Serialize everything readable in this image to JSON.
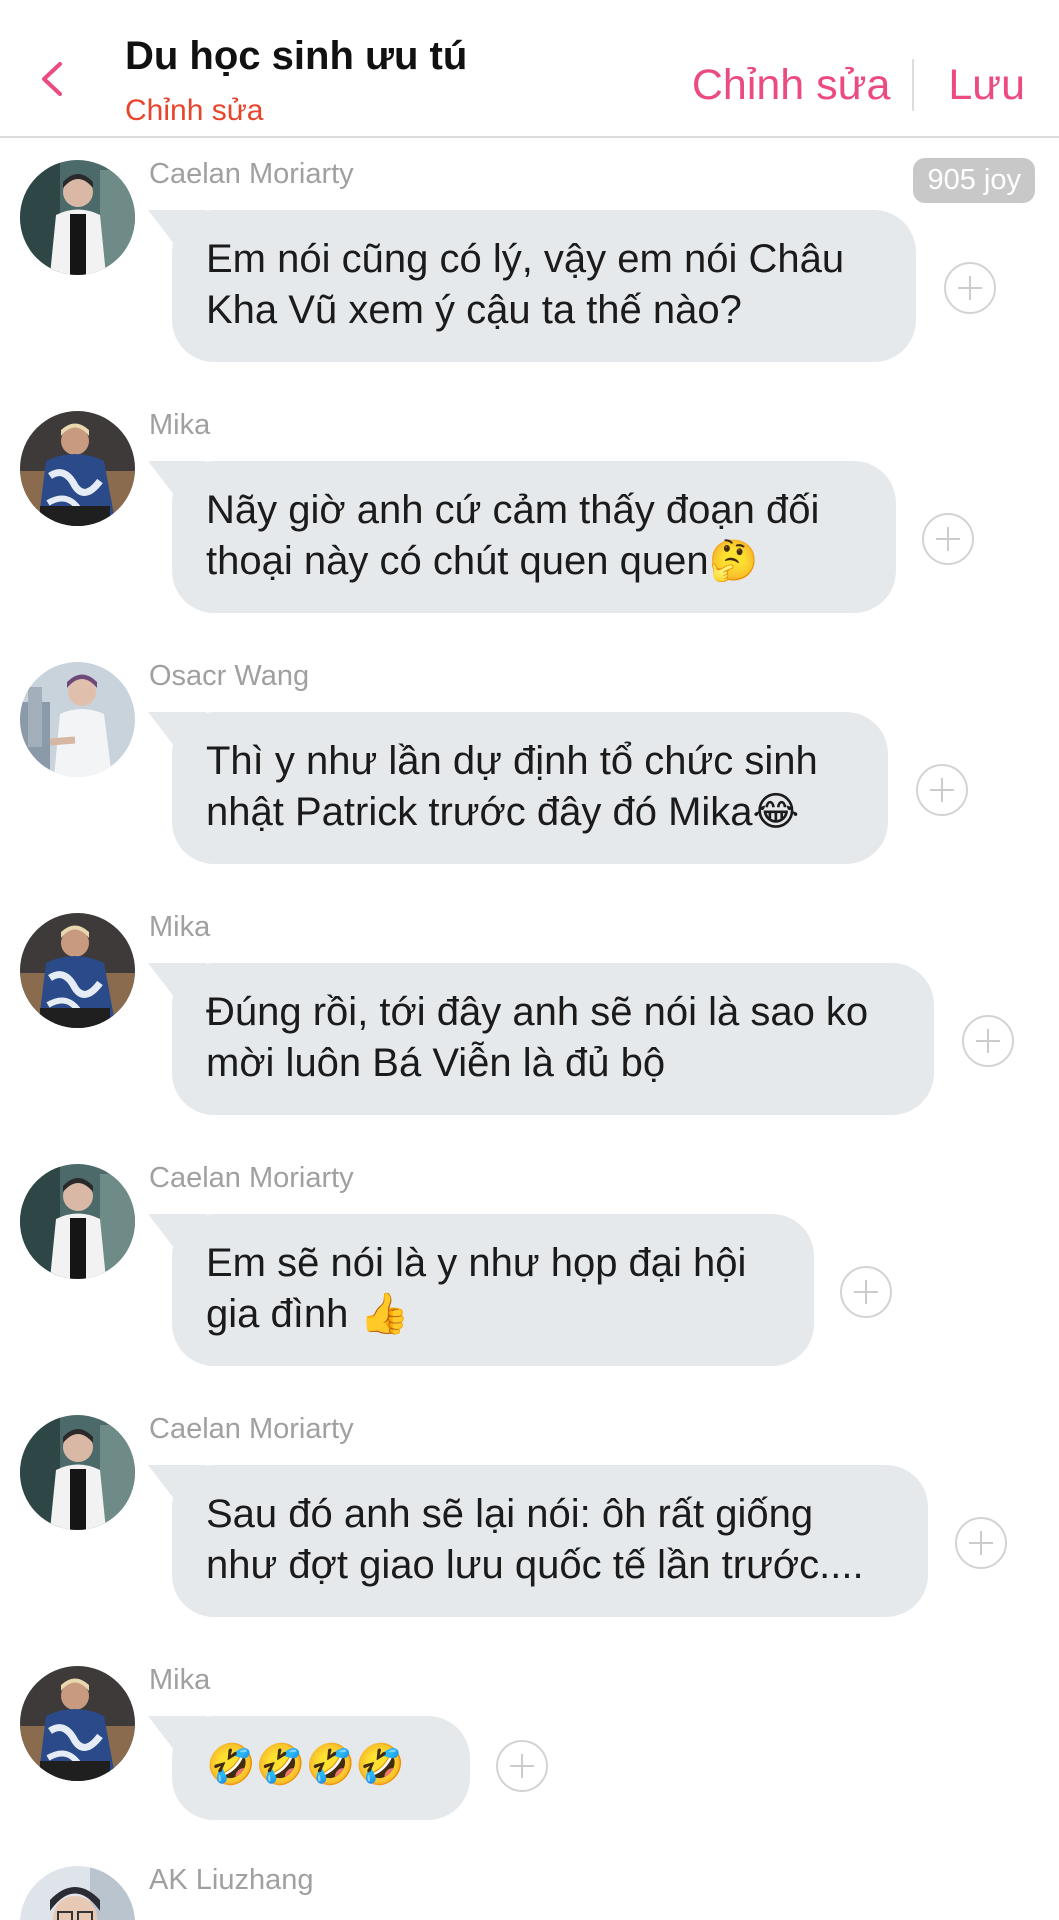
{
  "header": {
    "title": "Du học sinh ưu tú",
    "subtitle": "Chỉnh sửa",
    "edit_label": "Chỉnh sửa",
    "save_label": "Lưu"
  },
  "colors": {
    "accent": "#ec4a82",
    "subtitle": "#e8452c",
    "bubble": "#e6e9ec",
    "sender_text": "#a0a0a0",
    "badge": "#c8c8c8"
  },
  "messages": [
    {
      "sender": "Caelan Moriarty",
      "badge": "905 joy",
      "lines": [
        "Em nói cũng có lý, vậy em nói Châu",
        "Kha Vũ xem ý cậu ta thế nào?"
      ]
    },
    {
      "sender": "Mika",
      "lines": [
        "Nãy giờ anh cứ cảm thấy đoạn đối",
        "thoại này có chút quen quen🤔"
      ]
    },
    {
      "sender": "Osacr Wang",
      "lines": [
        "Thì y như lần dự định tổ chức sinh",
        "nhật Patrick trước đây đó Mika😂"
      ]
    },
    {
      "sender": "Mika",
      "lines": [
        "Đúng rồi, tới đây anh sẽ nói là sao ko",
        "mời luôn Bá Viễn là đủ bộ"
      ]
    },
    {
      "sender": "Caelan Moriarty",
      "lines": [
        "Em sẽ nói là y như họp đại hội",
        "gia đình 👍"
      ]
    },
    {
      "sender": "Caelan Moriarty",
      "lines": [
        "Sau đó anh sẽ lại nói: ôh rất giống",
        "như đợt giao lưu quốc tế lần trước...."
      ]
    },
    {
      "sender": "Mika",
      "lines": [
        "🤣🤣🤣🤣"
      ]
    },
    {
      "sender": "AK Liuzhang",
      "lines": []
    }
  ]
}
